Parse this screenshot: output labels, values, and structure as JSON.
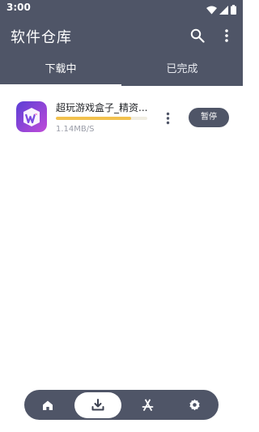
{
  "status_bar": {
    "time": "3:00"
  },
  "app_bar": {
    "title": "软件仓库"
  },
  "tabs": [
    {
      "label": "下载中",
      "active": true
    },
    {
      "label": "已完成",
      "active": false
    }
  ],
  "downloads": [
    {
      "name": "超玩游戏盒子_精资...",
      "speed": "1.14MB/S",
      "progress_percent": 82,
      "action_label": "暂停"
    }
  ],
  "bottom_nav": [
    {
      "icon": "home-icon",
      "active": false
    },
    {
      "icon": "download-icon",
      "active": true
    },
    {
      "icon": "app-store-icon",
      "active": false
    },
    {
      "icon": "settings-icon",
      "active": false
    }
  ],
  "colors": {
    "primary": "#4f5567",
    "progress": "#f2c14e",
    "background": "#ffffff"
  }
}
